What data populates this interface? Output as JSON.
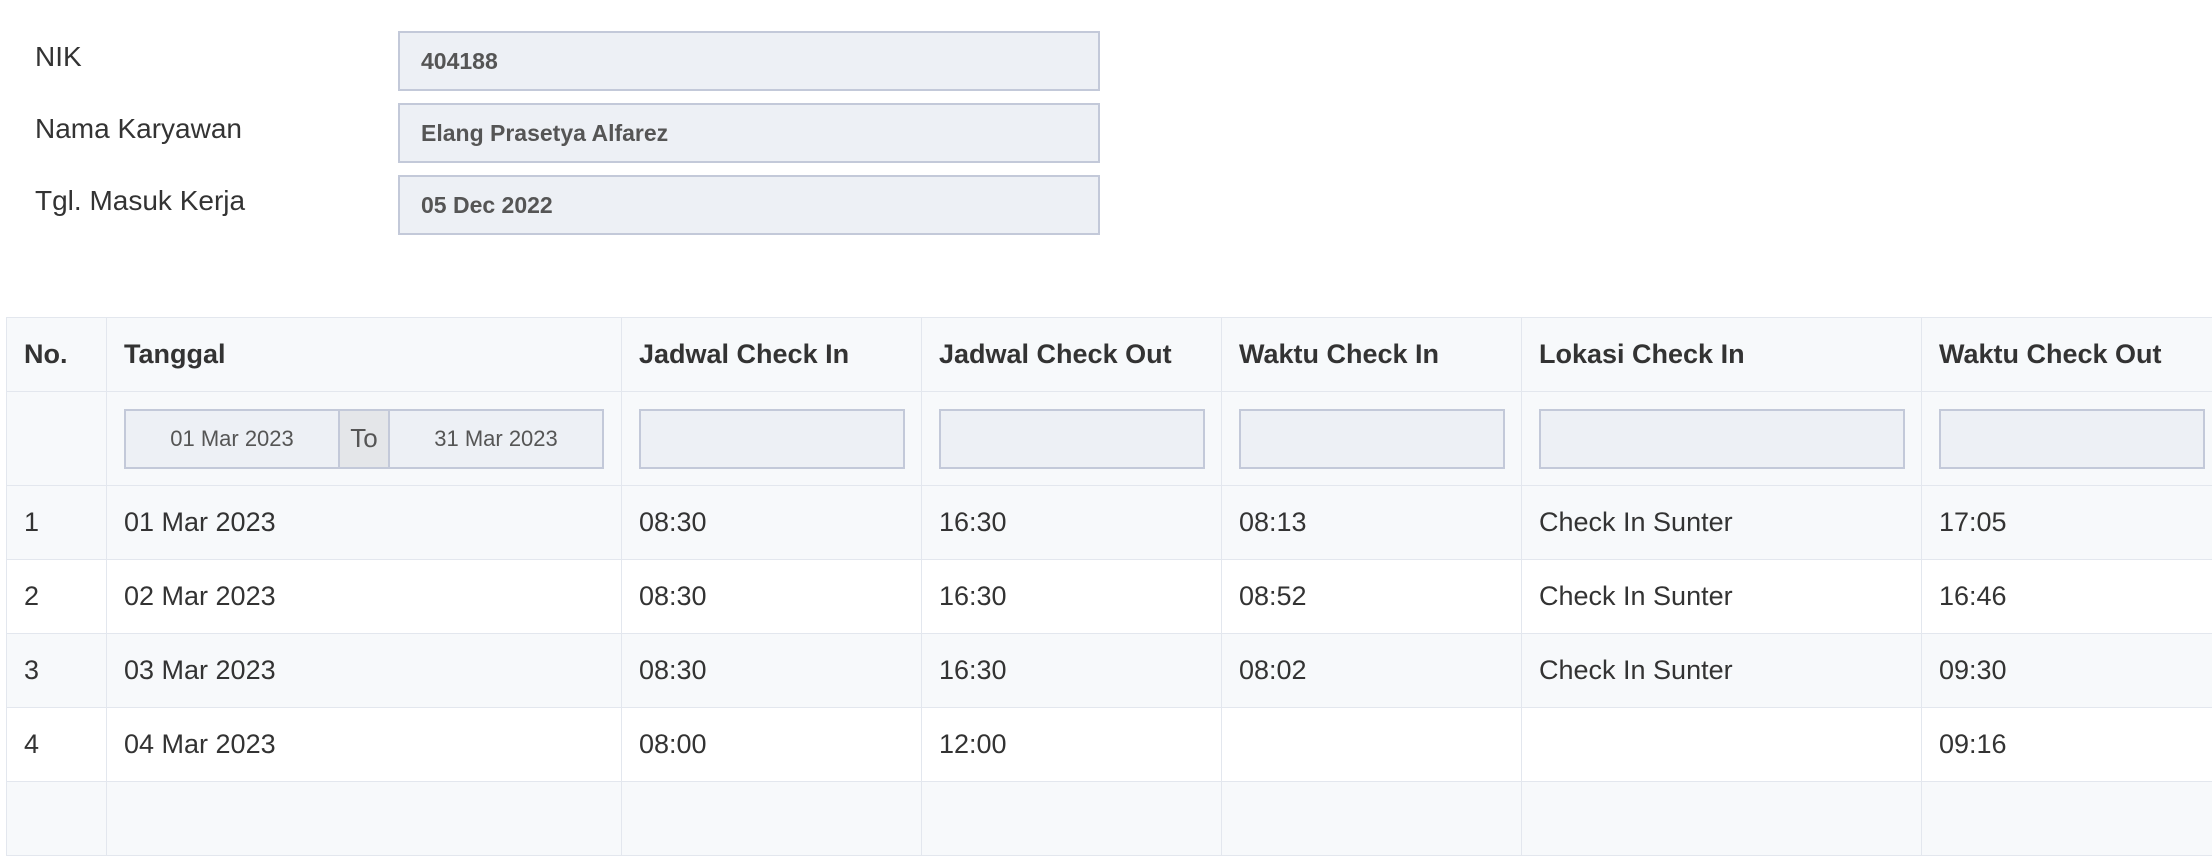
{
  "employee": {
    "nik_label": "NIK",
    "nik_value": "404188",
    "name_label": "Nama Karyawan",
    "name_value": "Elang Prasetya Alfarez",
    "join_label": "Tgl. Masuk Kerja",
    "join_value": "05 Dec 2022"
  },
  "table": {
    "headers": [
      "No.",
      "Tanggal",
      "Jadwal Check In",
      "Jadwal Check Out",
      "Waktu Check In",
      "Lokasi Check In",
      "Waktu Check Out"
    ],
    "filter": {
      "date_from": "01 Mar 2023",
      "date_sep": "To",
      "date_to": "31 Mar 2023"
    },
    "rows": [
      [
        "1",
        "01 Mar 2023",
        "08:30",
        "16:30",
        "08:13",
        "Check In Sunter",
        "17:05"
      ],
      [
        "2",
        "02 Mar 2023",
        "08:30",
        "16:30",
        "08:52",
        "Check In Sunter",
        "16:46"
      ],
      [
        "3",
        "03 Mar 2023",
        "08:30",
        "16:30",
        "08:02",
        "Check In Sunter",
        "09:30"
      ],
      [
        "4",
        "04 Mar 2023",
        "08:00",
        "12:00",
        "",
        "",
        "09:16"
      ],
      [
        "",
        "",
        "",
        "",
        "",
        "",
        ""
      ]
    ]
  }
}
